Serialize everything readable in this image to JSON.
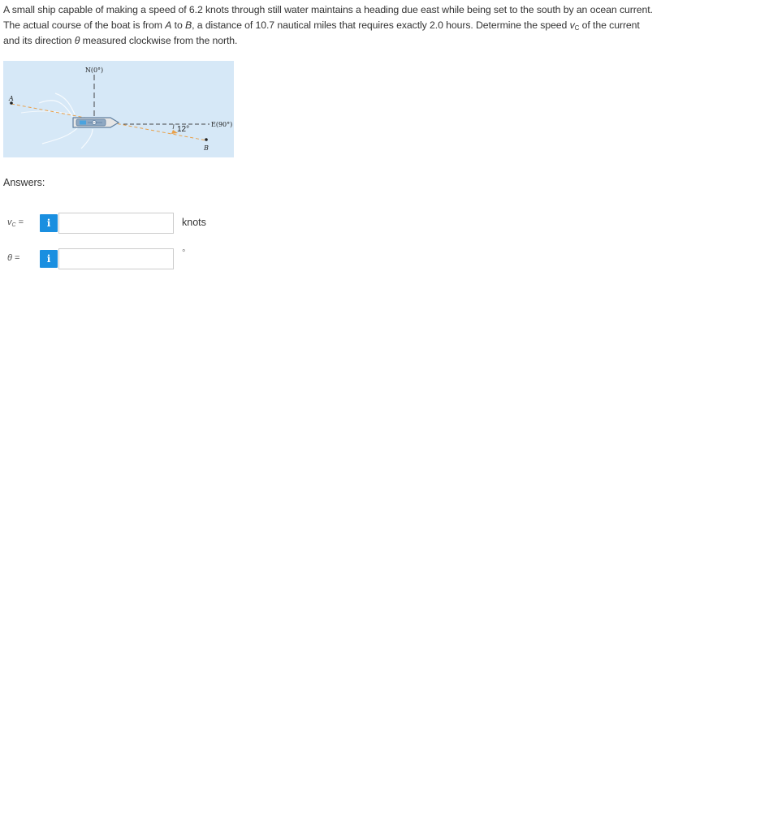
{
  "question": {
    "part1": "A small ship capable of making a speed of 6.2 knots through still water maintains a heading due east while being set to the south by an ocean current. The actual course of the boat is from ",
    "pointA": "A",
    "part2": " to ",
    "pointB": "B",
    "part3": ", a distance of 10.7 nautical miles that requires exactly 2.0 hours. Determine the speed ",
    "speed_var": "v",
    "speed_sub": "C",
    "part4": " of the current and its direction ",
    "theta": "θ",
    "part5": " measured clockwise from the north."
  },
  "figure": {
    "north_label": "N(0°)",
    "east_label": "E(90°)",
    "angle_label": "12°",
    "point_a": "A",
    "point_b": "B",
    "colors": {
      "water": "#d6e8f7",
      "course_line": "#e8a04a",
      "ship_hull": "#5f7fa0"
    }
  },
  "answers": {
    "label": "Answers:",
    "rows": [
      {
        "var": "v",
        "sub": "C",
        "eq": " =",
        "info_glyph": "i",
        "value": "",
        "unit": "knots"
      },
      {
        "var": "θ",
        "sub": "",
        "eq": " =",
        "info_glyph": "i",
        "value": "",
        "unit": "°"
      }
    ]
  }
}
